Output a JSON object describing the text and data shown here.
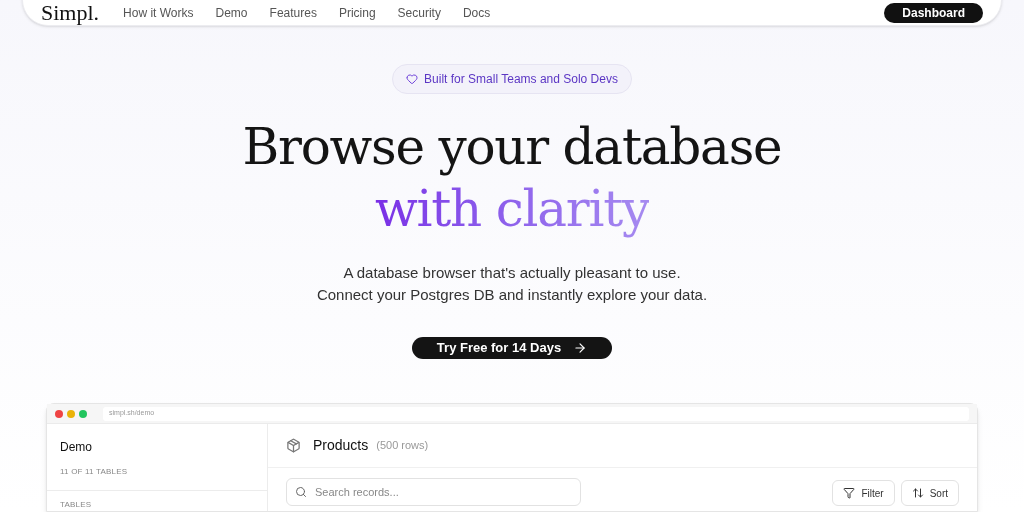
{
  "nav": {
    "logo": "Simpl.",
    "links": [
      "How it Works",
      "Demo",
      "Features",
      "Pricing",
      "Security",
      "Docs"
    ],
    "button": "Dashboard"
  },
  "badge": "Built for Small Teams and Solo Devs",
  "headline": {
    "line1": "Browse your database",
    "line2": "with clarity"
  },
  "subtitle": [
    "A database browser that's actually pleasant to use.",
    "Connect your Postgres DB and instantly explore your data."
  ],
  "cta": "Try Free for 14 Days",
  "demo": {
    "url": "simpl.sh/demo",
    "sidebar": {
      "title": "Demo",
      "count": "11 OF 11 TABLES",
      "section": "TABLES"
    },
    "table": {
      "title": "Products",
      "rows": "(500 rows)",
      "search_placeholder": "Search records...",
      "buttons": [
        {
          "kind": "filter",
          "label": "Filter"
        },
        {
          "kind": "sort",
          "label": "Sort"
        }
      ]
    }
  }
}
